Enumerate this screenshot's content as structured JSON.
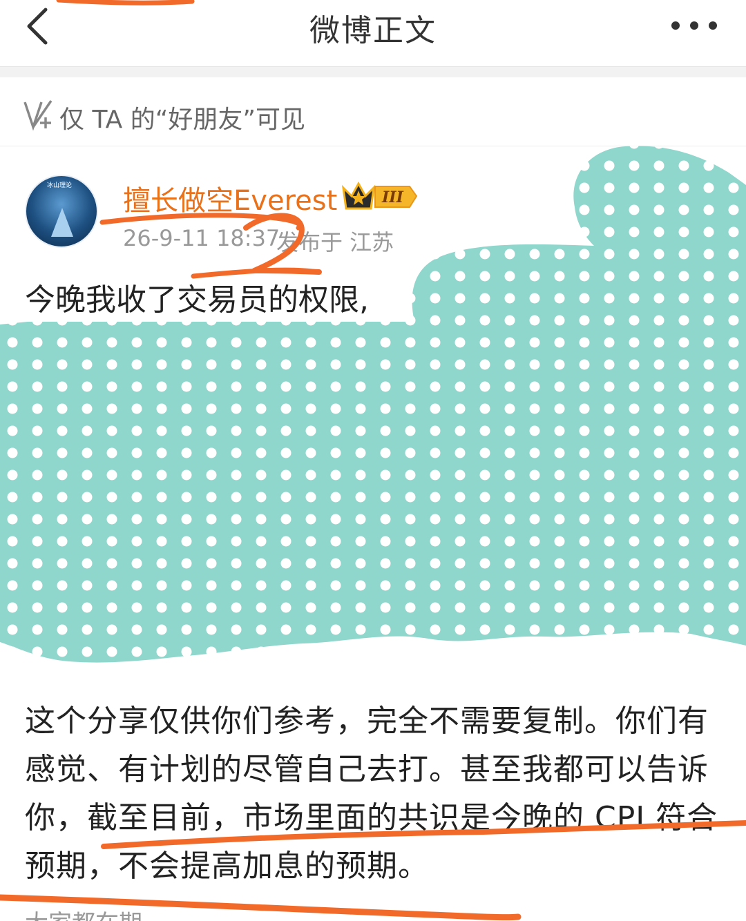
{
  "nav": {
    "title": "微博正文",
    "back_icon": "chevron-left-icon",
    "more_icon": "more-dots-icon"
  },
  "visibility": {
    "icon": "visibility-check-icon",
    "text": "仅 TA 的“好朋友”可见"
  },
  "post": {
    "author": "擅长做空Everest",
    "badge_text": "III",
    "timestamp": "26-9-11 18:37",
    "location": "发布于 江苏",
    "line1": "今晚我收了交易员的权限,",
    "body": "这个分享仅供你们参考，完全不需要复制。你们有感觉、有计划的尽管自己去打。甚至我都可以告诉你，截至目前，市场里面的共识是今晚的 CPI 符合预期，不会提高加息的预期。",
    "cutoff": "大家都在期"
  },
  "avatar": {
    "label": "冰山理论"
  },
  "colors": {
    "username": "#e8721c",
    "annotation": "#f26a2a",
    "mask": "#8fd6cc",
    "gap": "#f2f2f2"
  }
}
